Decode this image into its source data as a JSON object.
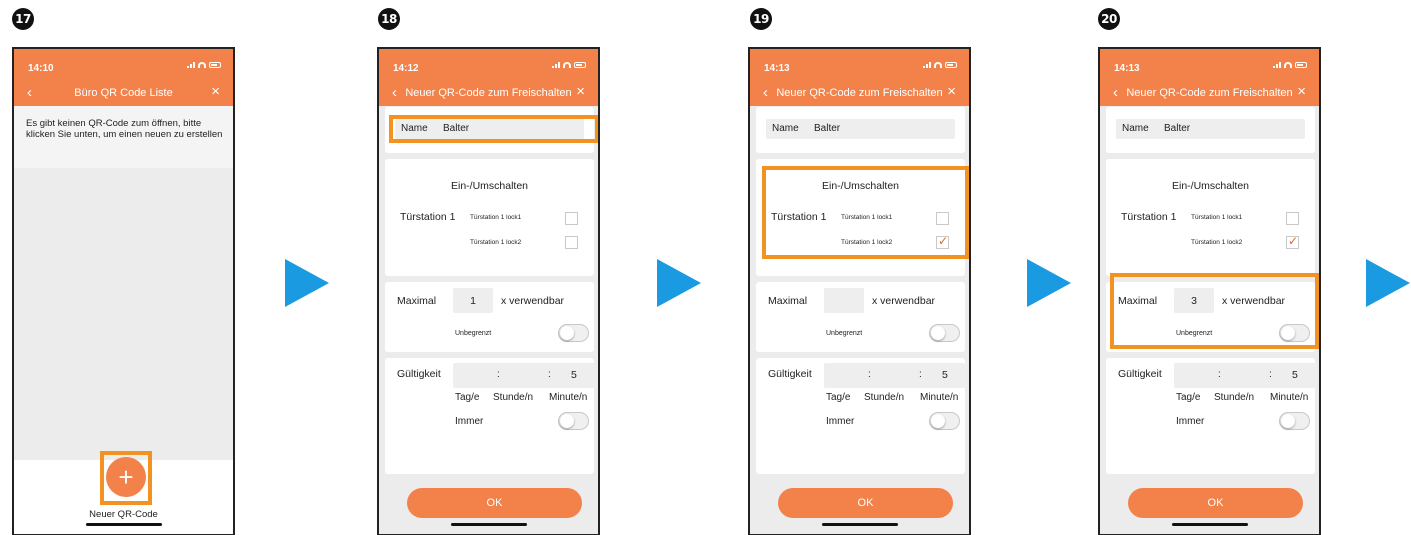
{
  "steps": [
    "17",
    "18",
    "19",
    "20"
  ],
  "screens": [
    {
      "time": "14:10",
      "title": "Büro QR Code Liste",
      "empty_message": "Es gibt keinen QR-Code zum öffnen, bitte klicken Sie unten, um einen neuen zu erstellen",
      "add_icon": "plus-icon",
      "add_label": "Neuer QR-Code"
    },
    {
      "time": "14:12",
      "title": "Neuer QR-Code zum Freischalten",
      "name_label": "Name",
      "name_value": "Balter",
      "switch_title": "Ein-/Umschalten",
      "station": "Türstation 1",
      "lock1": "Türstation 1 lock1",
      "lock2": "Türstation 1 lock2",
      "lock1_checked": false,
      "lock2_checked": false,
      "max_label": "Maximal",
      "max_value": "1",
      "usable_label": "x verwendbar",
      "unlimited_label": "Unbegrenzt",
      "validity_label": "Gültigkeit",
      "sep1": ":",
      "sep2": ":",
      "minutes_value": "5",
      "day_label": "Tag/e",
      "hour_label": "Stunde/n",
      "minute_label": "Minute/n",
      "always_label": "Immer",
      "ok_label": "OK"
    },
    {
      "time": "14:13",
      "title": "Neuer QR-Code zum Freischalten",
      "name_label": "Name",
      "name_value": "Balter",
      "switch_title": "Ein-/Umschalten",
      "station": "Türstation 1",
      "lock1": "Türstation 1 lock1",
      "lock2": "Türstation 1 lock2",
      "lock1_checked": false,
      "lock2_checked": true,
      "max_label": "Maximal",
      "max_value": "",
      "usable_label": "x verwendbar",
      "unlimited_label": "Unbegrenzt",
      "validity_label": "Gültigkeit",
      "sep1": ":",
      "sep2": ":",
      "minutes_value": "5",
      "day_label": "Tag/e",
      "hour_label": "Stunde/n",
      "minute_label": "Minute/n",
      "always_label": "Immer",
      "ok_label": "OK"
    },
    {
      "time": "14:13",
      "title": "Neuer QR-Code zum Freischalten",
      "name_label": "Name",
      "name_value": "Balter",
      "switch_title": "Ein-/Umschalten",
      "station": "Türstation 1",
      "lock1": "Türstation 1 lock1",
      "lock2": "Türstation 1 lock2",
      "lock1_checked": false,
      "lock2_checked": true,
      "max_label": "Maximal",
      "max_value": "3",
      "usable_label": "x verwendbar",
      "unlimited_label": "Unbegrenzt",
      "validity_label": "Gültigkeit",
      "sep1": ":",
      "sep2": ":",
      "minutes_value": "5",
      "day_label": "Tag/e",
      "hour_label": "Stunde/n",
      "minute_label": "Minute/n",
      "always_label": "Immer",
      "ok_label": "OK"
    }
  ],
  "colors": {
    "accent": "#f2824a",
    "highlight": "#f29222",
    "arrow": "#1a9ae0",
    "check": "#e2642a"
  }
}
